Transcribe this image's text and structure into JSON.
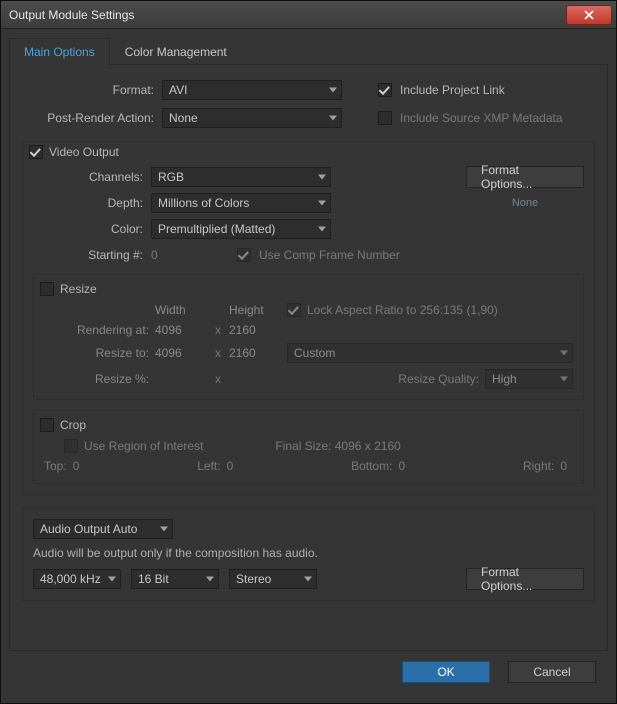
{
  "window": {
    "title": "Output Module Settings"
  },
  "tabs": {
    "main": "Main Options",
    "color": "Color Management"
  },
  "top": {
    "format_label": "Format:",
    "format_value": "AVI",
    "pra_label": "Post-Render Action:",
    "pra_value": "None",
    "include_project": "Include Project Link",
    "include_xmp": "Include Source XMP Metadata"
  },
  "video": {
    "header": "Video Output",
    "channels_label": "Channels:",
    "channels_value": "RGB",
    "depth_label": "Depth:",
    "depth_value": "Millions of Colors",
    "color_label": "Color:",
    "color_value": "Premultiplied (Matted)",
    "starting_label": "Starting #:",
    "starting_value": "0",
    "usecomp": "Use Comp Frame Number",
    "format_options": "Format Options...",
    "codec_hint": "None"
  },
  "resize": {
    "header": "Resize",
    "width": "Width",
    "height": "Height",
    "lock": "Lock Aspect Ratio to 256:135 (1,90)",
    "rendering_label": "Rendering at:",
    "rendering_w": "4096",
    "rendering_h": "2160",
    "resize_to_label": "Resize to:",
    "resize_w": "4096",
    "resize_h": "2160",
    "preset": "Custom",
    "resize_pct_label": "Resize %:",
    "resize_pct_w": "",
    "resize_pct_h": "",
    "quality_label": "Resize Quality:",
    "quality_value": "High"
  },
  "crop": {
    "header": "Crop",
    "use_roi": "Use Region of Interest",
    "final_size": "Final Size: 4096 x 2160",
    "top_l": "Top:",
    "top_v": "0",
    "left_l": "Left:",
    "left_v": "0",
    "bottom_l": "Bottom:",
    "bottom_v": "0",
    "right_l": "Right:",
    "right_v": "0"
  },
  "audio": {
    "mode": "Audio Output Auto",
    "note": "Audio will be output only if the composition has audio.",
    "rate": "48,000 kHz",
    "bits": "16 Bit",
    "chan": "Stereo",
    "format_options": "Format Options..."
  },
  "buttons": {
    "ok": "OK",
    "cancel": "Cancel"
  }
}
